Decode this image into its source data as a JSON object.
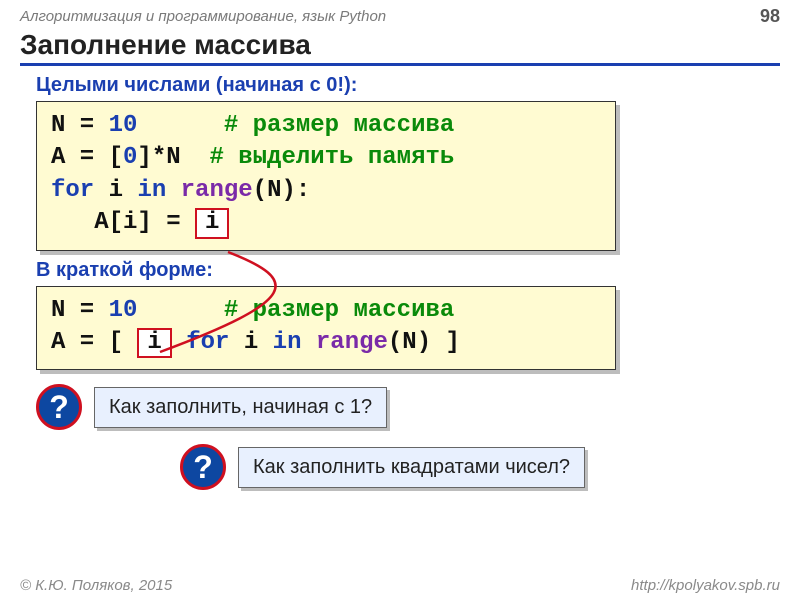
{
  "header": {
    "course": "Алгоритмизация и программирование, язык Python",
    "page": "98"
  },
  "title": "Заполнение массива",
  "sub1": "Целыми числами (начиная с 0!):",
  "code1": {
    "l1a": "N = ",
    "l1num": "10",
    "l1b": "      ",
    "l1c": "# размер массива",
    "l2a": "A = [",
    "l2zero": "0",
    "l2b": "]*N  ",
    "l2c": "# выделить память",
    "l3a": "for",
    "l3b": " i ",
    "l3c": "in",
    "l3d": " ",
    "l3e": "range",
    "l3f": "(N):",
    "l4a": "   A[i] = ",
    "l4i": "i"
  },
  "sub2": "В краткой форме:",
  "code2": {
    "l1a": "N = ",
    "l1num": "10",
    "l1b": "      ",
    "l1c": "# размер массива",
    "l2a": "A = [ ",
    "l2i": "i",
    "l2b": " ",
    "l2for": "for",
    "l2c": " i ",
    "l2in": "in",
    "l2d": " ",
    "l2range": "range",
    "l2e": "(N) ]"
  },
  "qmark": "?",
  "q1": "Как заполнить, начиная с 1?",
  "q2": "Как заполнить квадратами чисел?",
  "footer": {
    "left": "© К.Ю. Поляков, 2015",
    "right": "http://kpolyakov.spb.ru"
  }
}
